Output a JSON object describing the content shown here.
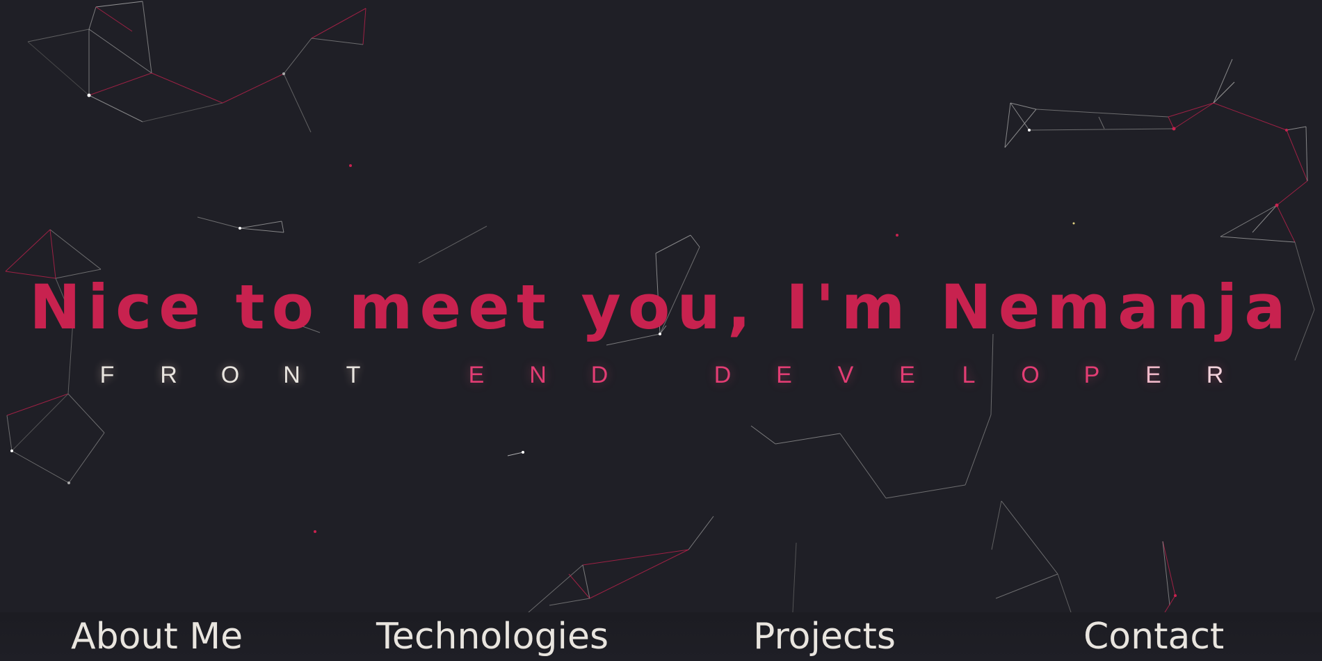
{
  "hero": {
    "title": "Nice to meet you, I'm Nemanja",
    "subtitle_letters": [
      "F",
      "R",
      "O",
      "N",
      "T",
      " ",
      "E",
      "N",
      "D",
      " ",
      "D",
      "E",
      "V",
      "E",
      "L",
      "O",
      "P",
      "E",
      "R"
    ]
  },
  "nav": {
    "items": [
      {
        "label": "About Me"
      },
      {
        "label": "Technologies"
      },
      {
        "label": "Projects"
      },
      {
        "label": "Contact"
      }
    ]
  },
  "colors": {
    "background": "#1f1f26",
    "accent": "#c8224f",
    "light_text": "#e9e5df",
    "pink_text": "#e33d74"
  }
}
